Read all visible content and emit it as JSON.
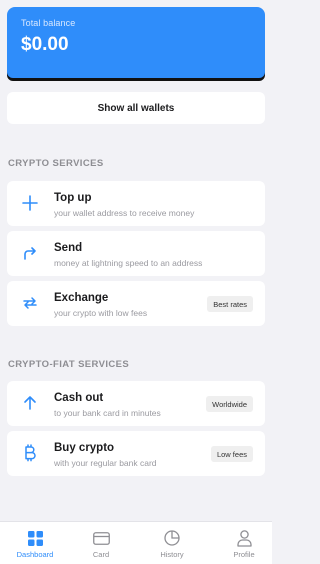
{
  "balance": {
    "label": "Total balance",
    "value": "$0.00"
  },
  "wallets": {
    "show_all_label": "Show all wallets"
  },
  "crypto_services": {
    "title": "CRYPTO SERVICES",
    "items": [
      {
        "icon": "plus-icon",
        "title": "Top up",
        "subtitle": "your wallet address to receive money",
        "badge": ""
      },
      {
        "icon": "send-arrow-icon",
        "title": "Send",
        "subtitle": "money at lightning speed to an address",
        "badge": ""
      },
      {
        "icon": "exchange-arrows-icon",
        "title": "Exchange",
        "subtitle": "your crypto with low fees",
        "badge": "Best rates"
      }
    ]
  },
  "fiat_services": {
    "title": "CRYPTO-FIAT SERVICES",
    "items": [
      {
        "icon": "arrow-up-icon",
        "title": "Cash out",
        "subtitle": "to your bank card in minutes",
        "badge": "Worldwide"
      },
      {
        "icon": "bitcoin-icon",
        "title": "Buy crypto",
        "subtitle": "with your regular bank card",
        "badge": "Low fees"
      }
    ]
  },
  "tabbar": {
    "tabs": [
      {
        "icon": "dashboard-grid-icon",
        "label": "Dashboard",
        "active": true
      },
      {
        "icon": "card-icon",
        "label": "Card",
        "active": false
      },
      {
        "icon": "history-pie-icon",
        "label": "History",
        "active": false
      },
      {
        "icon": "profile-icon",
        "label": "Profile",
        "active": false
      }
    ]
  },
  "colors": {
    "accent": "#2f8dfa",
    "background": "#f2f2f6",
    "muted": "#8e8e93"
  }
}
